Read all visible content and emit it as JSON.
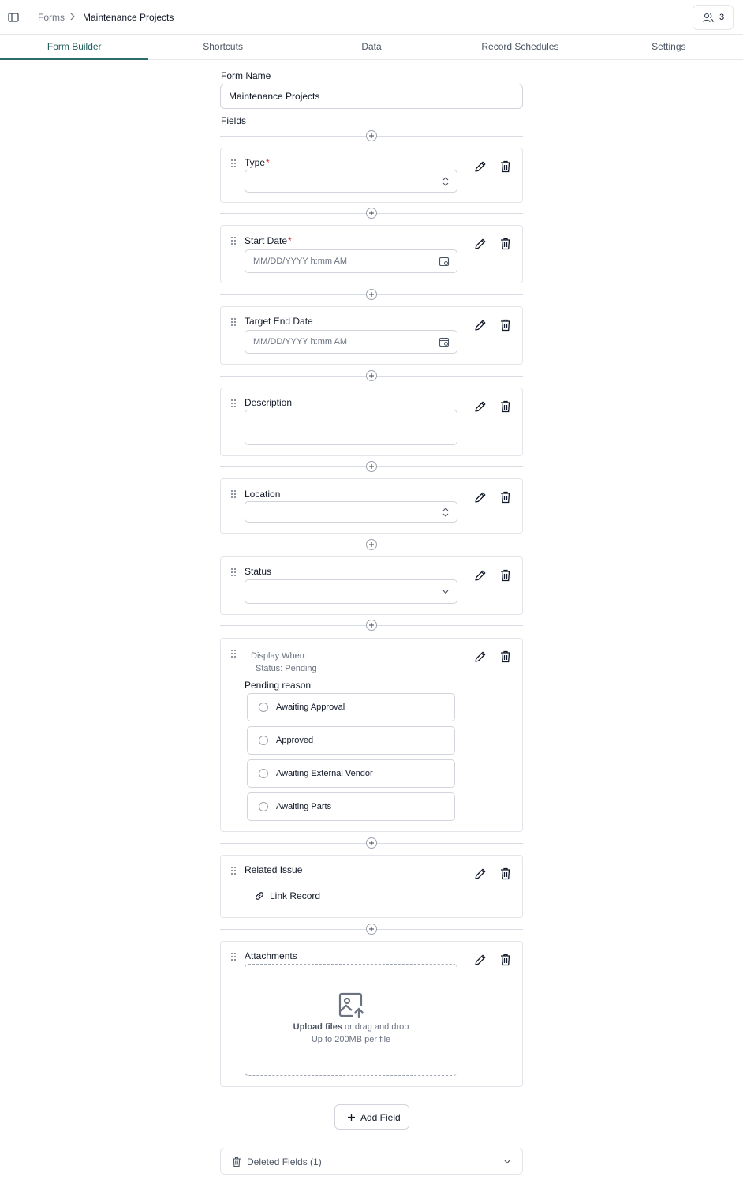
{
  "breadcrumb": {
    "root": "Forms",
    "current": "Maintenance Projects"
  },
  "users": {
    "count": "3"
  },
  "tabs": [
    "Form Builder",
    "Shortcuts",
    "Data",
    "Record Schedules",
    "Settings"
  ],
  "form": {
    "name_label": "Form Name",
    "name_value": "Maintenance Projects",
    "fields_label": "Fields"
  },
  "fields": {
    "type": {
      "label": "Type",
      "required": "*"
    },
    "start_date": {
      "label": "Start Date",
      "required": "*",
      "placeholder": "MM/DD/YYYY h:mm AM"
    },
    "target_end_date": {
      "label": "Target End Date",
      "placeholder": "MM/DD/YYYY h:mm AM"
    },
    "description": {
      "label": "Description"
    },
    "location": {
      "label": "Location"
    },
    "status": {
      "label": "Status"
    },
    "pending_reason": {
      "display_when": "Display When:",
      "condition": "Status: Pending",
      "label": "Pending reason",
      "options": [
        "Awaiting Approval",
        "Approved",
        "Awaiting External Vendor",
        "Awaiting Parts"
      ]
    },
    "related_issue": {
      "label": "Related Issue",
      "link_label": "Link Record"
    },
    "attachments": {
      "label": "Attachments",
      "upload_strong": "Upload files",
      "upload_rest": " or drag and drop",
      "limit": "Up to 200MB per file"
    }
  },
  "actions": {
    "add_field": "Add Field",
    "deleted_fields": "Deleted Fields (1)"
  },
  "colors": {
    "accent": "#2b6b6b",
    "required": "#dc2626",
    "border": "#e2e5ea"
  }
}
